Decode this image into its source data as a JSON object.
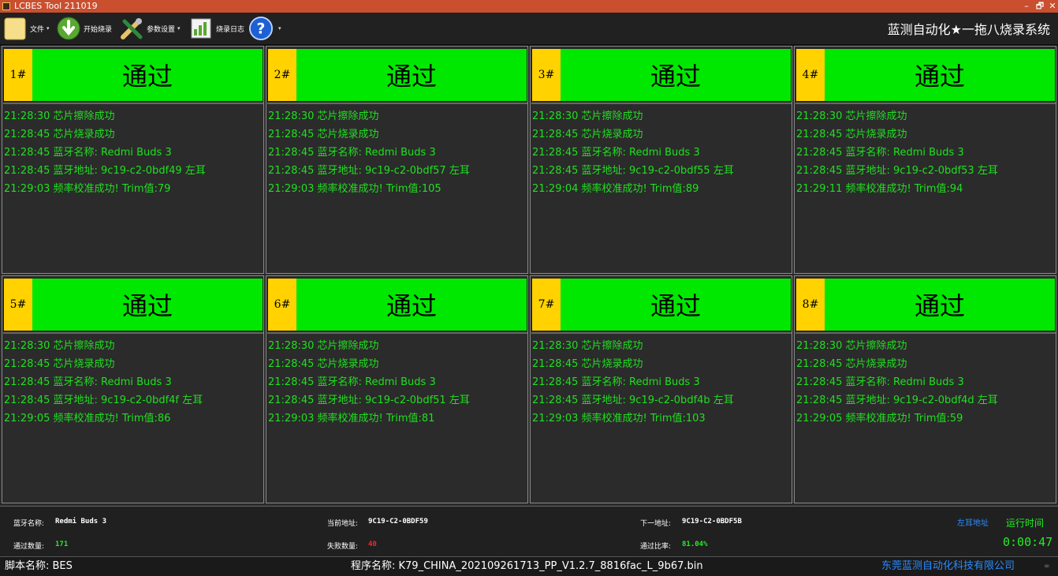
{
  "window": {
    "title": "LCBES Tool 211019",
    "minimize": "–",
    "restore": "🗗",
    "close": "✕"
  },
  "toolbar": {
    "file_label": "文件",
    "start_label": "开始烧录",
    "params_label": "参数设置",
    "log_label": "烧录日志",
    "caret": "▾",
    "system_name": "蓝测自动化★一拖八烧录系统"
  },
  "panels": [
    {
      "num": "1#",
      "status": "通过",
      "logs": [
        "21:28:30  芯片擦除成功",
        "21:28:45  芯片烧录成功",
        "21:28:45  蓝牙名称: Redmi Buds 3",
        "21:28:45  蓝牙地址: 9c19-c2-0bdf49   左耳",
        "21:29:03  频率校准成功!  Trim值:79"
      ]
    },
    {
      "num": "2#",
      "status": "通过",
      "logs": [
        "21:28:30  芯片擦除成功",
        "21:28:45  芯片烧录成功",
        "21:28:45  蓝牙名称: Redmi Buds 3",
        "21:28:45  蓝牙地址: 9c19-c2-0bdf57   左耳",
        "21:29:03  频率校准成功!  Trim值:105"
      ]
    },
    {
      "num": "3#",
      "status": "通过",
      "logs": [
        "21:28:30  芯片擦除成功",
        "21:28:45  芯片烧录成功",
        "21:28:45  蓝牙名称: Redmi Buds 3",
        "21:28:45  蓝牙地址: 9c19-c2-0bdf55   左耳",
        "21:29:04  频率校准成功!  Trim值:89"
      ]
    },
    {
      "num": "4#",
      "status": "通过",
      "logs": [
        "21:28:30  芯片擦除成功",
        "21:28:45  芯片烧录成功",
        "21:28:45  蓝牙名称: Redmi Buds 3",
        "21:28:45  蓝牙地址: 9c19-c2-0bdf53   左耳",
        "21:29:11  频率校准成功!  Trim值:94"
      ]
    },
    {
      "num": "5#",
      "status": "通过",
      "logs": [
        "21:28:30  芯片擦除成功",
        "21:28:45  芯片烧录成功",
        "21:28:45  蓝牙名称: Redmi Buds 3",
        "21:28:45  蓝牙地址: 9c19-c2-0bdf4f   左耳",
        "21:29:05  频率校准成功!  Trim值:86"
      ]
    },
    {
      "num": "6#",
      "status": "通过",
      "logs": [
        "21:28:30  芯片擦除成功",
        "21:28:45  芯片烧录成功",
        "21:28:45  蓝牙名称: Redmi Buds 3",
        "21:28:45  蓝牙地址: 9c19-c2-0bdf51   左耳",
        "21:29:03  频率校准成功!  Trim值:81"
      ]
    },
    {
      "num": "7#",
      "status": "通过",
      "logs": [
        "21:28:30  芯片擦除成功",
        "21:28:45  芯片烧录成功",
        "21:28:45  蓝牙名称: Redmi Buds 3",
        "21:28:45  蓝牙地址: 9c19-c2-0bdf4b   左耳",
        "21:29:03  频率校准成功!  Trim值:103"
      ]
    },
    {
      "num": "8#",
      "status": "通过",
      "logs": [
        "21:28:30  芯片擦除成功",
        "21:28:45  芯片烧录成功",
        "21:28:45  蓝牙名称: Redmi Buds 3",
        "21:28:45  蓝牙地址: 9c19-c2-0bdf4d   左耳",
        "21:29:05  频率校准成功!  Trim值:59"
      ]
    }
  ],
  "info": {
    "bt_name_label": "蓝牙名称:",
    "bt_name": "Redmi Buds 3",
    "cur_addr_label": "当前地址:",
    "cur_addr": "9C19-C2-0BDF59",
    "next_addr_label": "下一地址:",
    "next_addr": "9C19-C2-0BDF5B",
    "left_addr_link": "左耳地址",
    "pass_label": "通过数量:",
    "pass_count": "171",
    "fail_label": "失败数量:",
    "fail_count": "40",
    "rate_label": "通过比率:",
    "pass_rate": "81.04%",
    "run_time_label": "运行时间",
    "run_time": "0:00:47"
  },
  "statusbar": {
    "script": "脚本名称: BES",
    "program": "程序名称: K79_CHINA_202109261713_PP_V1.2.7_8816fac_L_9b67.bin",
    "company": "东莞蓝测自动化科技有限公司",
    "corner": "∞"
  },
  "colors": {
    "pass_green": "#00e800",
    "slot_yellow": "#ffd200",
    "log_green": "#1fe01f",
    "title_red": "#c94f2f"
  }
}
